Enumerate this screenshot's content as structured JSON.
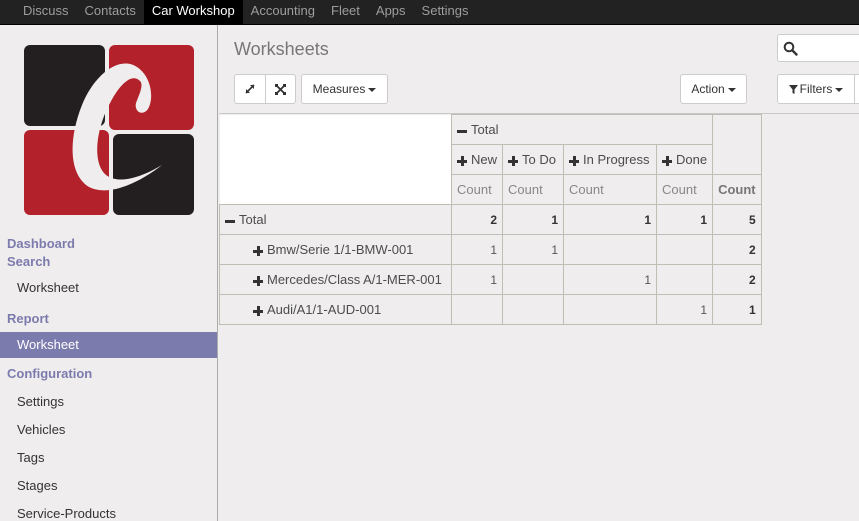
{
  "topnav": {
    "items": [
      {
        "label": "Discuss",
        "active": false
      },
      {
        "label": "Contacts",
        "active": false
      },
      {
        "label": "Car Workshop",
        "active": true
      },
      {
        "label": "Accounting",
        "active": false
      },
      {
        "label": "Fleet",
        "active": false
      },
      {
        "label": "Apps",
        "active": false
      },
      {
        "label": "Settings",
        "active": false
      }
    ]
  },
  "brand": {
    "colors": {
      "red": "#b3222a",
      "black": "#231f20",
      "accent": "#7c7bad"
    }
  },
  "sidebar": {
    "sections": [
      {
        "label": "Dashboard"
      },
      {
        "label": "Search",
        "items": [
          {
            "label": "Worksheet",
            "active": false
          }
        ]
      },
      {
        "label": "Report",
        "items": [
          {
            "label": "Worksheet",
            "active": true
          }
        ]
      },
      {
        "label": "Configuration",
        "items": [
          {
            "label": "Settings",
            "active": false
          },
          {
            "label": "Vehicles",
            "active": false
          },
          {
            "label": "Tags",
            "active": false
          },
          {
            "label": "Stages",
            "active": false
          },
          {
            "label": "Service-Products",
            "active": false
          }
        ]
      }
    ]
  },
  "control_panel": {
    "title": "Worksheets",
    "expand_icon": "expand-arrows-icon",
    "flip_icon": "compress-icon",
    "measures_label": "Measures",
    "action_label": "Action",
    "filters_label": "Filters",
    "search_placeholder": ""
  },
  "pivot": {
    "col_group_label": "Total",
    "columns": [
      "New",
      "To Do",
      "In Progress",
      "Done"
    ],
    "measure_label": "Count",
    "total_measure_label": "Count",
    "total_row": {
      "label": "Total",
      "values": [
        "2",
        "1",
        "1",
        "1"
      ],
      "total": "5"
    },
    "rows": [
      {
        "label": "Bmw/Serie 1/1-BMW-001",
        "values": [
          "1",
          "1",
          "",
          ""
        ],
        "total": "2"
      },
      {
        "label": "Mercedes/Class A/1-MER-001",
        "values": [
          "1",
          "",
          "1",
          ""
        ],
        "total": "2"
      },
      {
        "label": "Audi/A1/1-AUD-001",
        "values": [
          "",
          "",
          "",
          "1"
        ],
        "total": "1"
      }
    ]
  }
}
